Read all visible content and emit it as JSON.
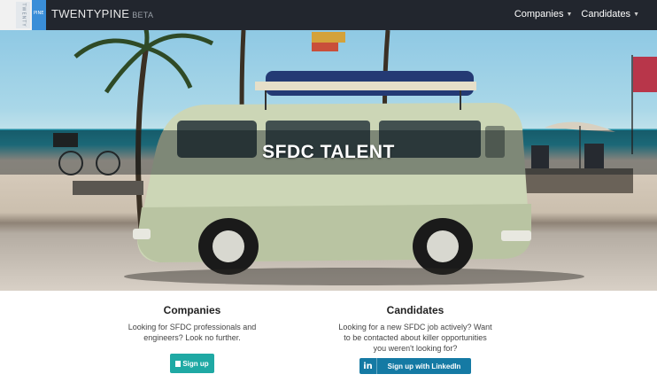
{
  "logo": {
    "twenty_text": "TWENTY",
    "pine_text": "PINE"
  },
  "brand": {
    "name": "TWENTYPINE",
    "badge": "BETA"
  },
  "nav": [
    {
      "label": "Companies"
    },
    {
      "label": "Candidates"
    }
  ],
  "hero": {
    "title": "SFDC TALENT"
  },
  "companies": {
    "heading": "Companies",
    "text": "Looking for SFDC professionals and engineers? Look no further.",
    "button_label": "Sign up"
  },
  "candidates": {
    "heading": "Candidates",
    "text": "Looking for a new SFDC job actively? Want to be contacted about killer opportunities you weren't looking for?",
    "button_label": "Sign up with LinkedIn",
    "button_icon": "in"
  },
  "colors": {
    "navbar": "#22262e",
    "accent_teal": "#1fa9a4",
    "linkedin_blue": "#157aa4",
    "logo_blue": "#3a8ed8"
  }
}
